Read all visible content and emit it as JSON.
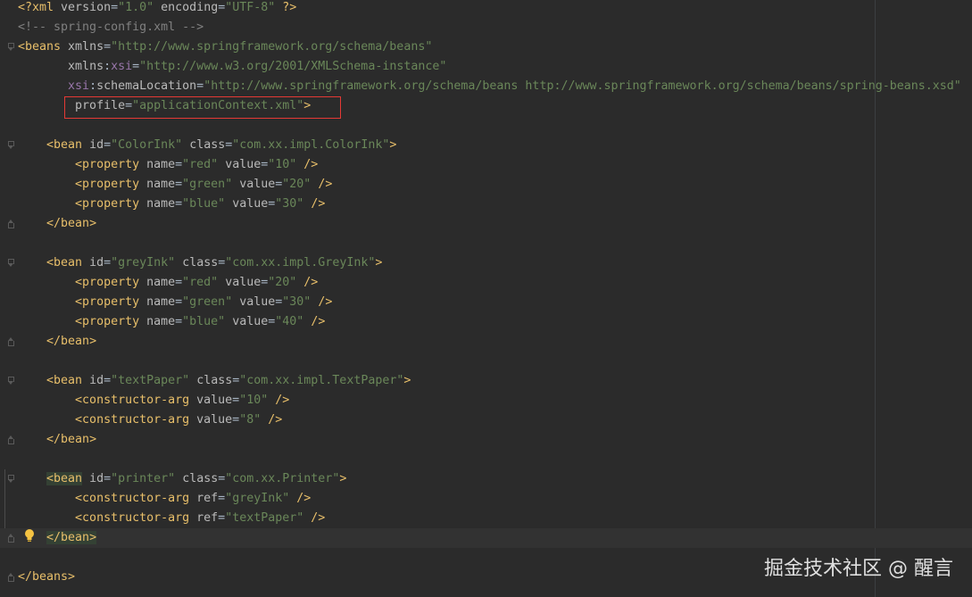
{
  "editor": {
    "language": "xml",
    "filename": "spring-config.xml",
    "highlighted_attribute": "profile=\"applicationContext.xml\"",
    "current_line_index": 27
  },
  "colors": {
    "background": "#2b2b2b",
    "tag": "#e8bf6a",
    "attribute": "#bababa",
    "value": "#6a8759",
    "comment": "#808080",
    "namespace": "#9876aa",
    "highlight_box": "#e53935"
  },
  "lines": [
    {
      "fold": "",
      "tokens": [
        [
          "tag",
          "<?xml "
        ],
        [
          "attr",
          "version"
        ],
        [
          "txt",
          "="
        ],
        [
          "val",
          "\"1.0\""
        ],
        [
          "txt",
          " "
        ],
        [
          "attr",
          "encoding"
        ],
        [
          "txt",
          "="
        ],
        [
          "val",
          "\"UTF-8\""
        ],
        [
          "txt",
          " "
        ],
        [
          "tag",
          "?>"
        ]
      ]
    },
    {
      "fold": "",
      "tokens": [
        [
          "cmt",
          "<!-- spring-config.xml -->"
        ]
      ]
    },
    {
      "fold": "open",
      "tokens": [
        [
          "tag",
          "<beans "
        ],
        [
          "attr",
          "xmlns"
        ],
        [
          "txt",
          "="
        ],
        [
          "val",
          "\"http://www.springframework.org/schema/beans\""
        ]
      ]
    },
    {
      "fold": "",
      "tokens": [
        [
          "txt",
          "       "
        ],
        [
          "attr",
          "xmlns"
        ],
        [
          "txt",
          ":"
        ],
        [
          "ns",
          "xsi"
        ],
        [
          "txt",
          "="
        ],
        [
          "val",
          "\"http://www.w3.org/2001/XMLSchema-instance\""
        ]
      ]
    },
    {
      "fold": "",
      "tokens": [
        [
          "txt",
          "       "
        ],
        [
          "ns",
          "xsi"
        ],
        [
          "txt",
          ":"
        ],
        [
          "attr",
          "schemaLocation"
        ],
        [
          "txt",
          "="
        ],
        [
          "val",
          "\"http://www.springframework.org/schema/beans http://www.springframework.org/schema/beans/spring-beans.xsd\""
        ]
      ]
    },
    {
      "fold": "",
      "tokens": [
        [
          "txt",
          "        "
        ],
        [
          "attr",
          "profile"
        ],
        [
          "txt",
          "="
        ],
        [
          "val",
          "\"applicationContext.xml\""
        ],
        [
          "tag",
          ">"
        ]
      ]
    },
    {
      "fold": "",
      "tokens": []
    },
    {
      "fold": "open",
      "tokens": [
        [
          "txt",
          "    "
        ],
        [
          "tag",
          "<bean "
        ],
        [
          "attr",
          "id"
        ],
        [
          "txt",
          "="
        ],
        [
          "val",
          "\"ColorInk\""
        ],
        [
          "txt",
          " "
        ],
        [
          "attr",
          "class"
        ],
        [
          "txt",
          "="
        ],
        [
          "val",
          "\"com.xx.impl.ColorInk\""
        ],
        [
          "tag",
          ">"
        ]
      ]
    },
    {
      "fold": "",
      "tokens": [
        [
          "txt",
          "        "
        ],
        [
          "tag",
          "<property "
        ],
        [
          "attr",
          "name"
        ],
        [
          "txt",
          "="
        ],
        [
          "val",
          "\"red\""
        ],
        [
          "txt",
          " "
        ],
        [
          "attr",
          "value"
        ],
        [
          "txt",
          "="
        ],
        [
          "val",
          "\"10\""
        ],
        [
          "txt",
          " "
        ],
        [
          "tag",
          "/>"
        ]
      ]
    },
    {
      "fold": "",
      "tokens": [
        [
          "txt",
          "        "
        ],
        [
          "tag",
          "<property "
        ],
        [
          "attr",
          "name"
        ],
        [
          "txt",
          "="
        ],
        [
          "val",
          "\"green\""
        ],
        [
          "txt",
          " "
        ],
        [
          "attr",
          "value"
        ],
        [
          "txt",
          "="
        ],
        [
          "val",
          "\"20\""
        ],
        [
          "txt",
          " "
        ],
        [
          "tag",
          "/>"
        ]
      ]
    },
    {
      "fold": "",
      "tokens": [
        [
          "txt",
          "        "
        ],
        [
          "tag",
          "<property "
        ],
        [
          "attr",
          "name"
        ],
        [
          "txt",
          "="
        ],
        [
          "val",
          "\"blue\""
        ],
        [
          "txt",
          " "
        ],
        [
          "attr",
          "value"
        ],
        [
          "txt",
          "="
        ],
        [
          "val",
          "\"30\""
        ],
        [
          "txt",
          " "
        ],
        [
          "tag",
          "/>"
        ]
      ]
    },
    {
      "fold": "close",
      "tokens": [
        [
          "txt",
          "    "
        ],
        [
          "tag",
          "</bean>"
        ]
      ]
    },
    {
      "fold": "",
      "tokens": []
    },
    {
      "fold": "open",
      "tokens": [
        [
          "txt",
          "    "
        ],
        [
          "tag",
          "<bean "
        ],
        [
          "attr",
          "id"
        ],
        [
          "txt",
          "="
        ],
        [
          "val",
          "\"greyInk\""
        ],
        [
          "txt",
          " "
        ],
        [
          "attr",
          "class"
        ],
        [
          "txt",
          "="
        ],
        [
          "val",
          "\"com.xx.impl.GreyInk\""
        ],
        [
          "tag",
          ">"
        ]
      ]
    },
    {
      "fold": "",
      "tokens": [
        [
          "txt",
          "        "
        ],
        [
          "tag",
          "<property "
        ],
        [
          "attr",
          "name"
        ],
        [
          "txt",
          "="
        ],
        [
          "val",
          "\"red\""
        ],
        [
          "txt",
          " "
        ],
        [
          "attr",
          "value"
        ],
        [
          "txt",
          "="
        ],
        [
          "val",
          "\"20\""
        ],
        [
          "txt",
          " "
        ],
        [
          "tag",
          "/>"
        ]
      ]
    },
    {
      "fold": "",
      "tokens": [
        [
          "txt",
          "        "
        ],
        [
          "tag",
          "<property "
        ],
        [
          "attr",
          "name"
        ],
        [
          "txt",
          "="
        ],
        [
          "val",
          "\"green\""
        ],
        [
          "txt",
          " "
        ],
        [
          "attr",
          "value"
        ],
        [
          "txt",
          "="
        ],
        [
          "val",
          "\"30\""
        ],
        [
          "txt",
          " "
        ],
        [
          "tag",
          "/>"
        ]
      ]
    },
    {
      "fold": "",
      "tokens": [
        [
          "txt",
          "        "
        ],
        [
          "tag",
          "<property "
        ],
        [
          "attr",
          "name"
        ],
        [
          "txt",
          "="
        ],
        [
          "val",
          "\"blue\""
        ],
        [
          "txt",
          " "
        ],
        [
          "attr",
          "value"
        ],
        [
          "txt",
          "="
        ],
        [
          "val",
          "\"40\""
        ],
        [
          "txt",
          " "
        ],
        [
          "tag",
          "/>"
        ]
      ]
    },
    {
      "fold": "close",
      "tokens": [
        [
          "txt",
          "    "
        ],
        [
          "tag",
          "</bean>"
        ]
      ]
    },
    {
      "fold": "",
      "tokens": []
    },
    {
      "fold": "open",
      "tokens": [
        [
          "txt",
          "    "
        ],
        [
          "tag",
          "<bean "
        ],
        [
          "attr",
          "id"
        ],
        [
          "txt",
          "="
        ],
        [
          "val",
          "\"textPaper\""
        ],
        [
          "txt",
          " "
        ],
        [
          "attr",
          "class"
        ],
        [
          "txt",
          "="
        ],
        [
          "val",
          "\"com.xx.impl.TextPaper\""
        ],
        [
          "tag",
          ">"
        ]
      ]
    },
    {
      "fold": "",
      "tokens": [
        [
          "txt",
          "        "
        ],
        [
          "tag",
          "<constructor-arg "
        ],
        [
          "attr",
          "value"
        ],
        [
          "txt",
          "="
        ],
        [
          "val",
          "\"10\""
        ],
        [
          "txt",
          " "
        ],
        [
          "tag",
          "/>"
        ]
      ]
    },
    {
      "fold": "",
      "tokens": [
        [
          "txt",
          "        "
        ],
        [
          "tag",
          "<constructor-arg "
        ],
        [
          "attr",
          "value"
        ],
        [
          "txt",
          "="
        ],
        [
          "val",
          "\"8\""
        ],
        [
          "txt",
          " "
        ],
        [
          "tag",
          "/>"
        ]
      ]
    },
    {
      "fold": "close",
      "tokens": [
        [
          "txt",
          "    "
        ],
        [
          "tag",
          "</bean>"
        ]
      ]
    },
    {
      "fold": "",
      "tokens": []
    },
    {
      "fold": "open",
      "tokens": [
        [
          "txt",
          "    "
        ],
        [
          "taghl",
          "<bean"
        ],
        [
          "tag",
          " "
        ],
        [
          "attr",
          "id"
        ],
        [
          "txt",
          "="
        ],
        [
          "val",
          "\"printer\""
        ],
        [
          "txt",
          " "
        ],
        [
          "attr",
          "class"
        ],
        [
          "txt",
          "="
        ],
        [
          "val",
          "\"com.xx.Printer\""
        ],
        [
          "tag",
          ">"
        ]
      ]
    },
    {
      "fold": "",
      "tokens": [
        [
          "txt",
          "        "
        ],
        [
          "tag",
          "<constructor-arg "
        ],
        [
          "attr",
          "ref"
        ],
        [
          "txt",
          "="
        ],
        [
          "val",
          "\"greyInk\""
        ],
        [
          "txt",
          " "
        ],
        [
          "tag",
          "/>"
        ]
      ]
    },
    {
      "fold": "",
      "tokens": [
        [
          "txt",
          "        "
        ],
        [
          "tag",
          "<constructor-arg "
        ],
        [
          "attr",
          "ref"
        ],
        [
          "txt",
          "="
        ],
        [
          "val",
          "\"textPaper\""
        ],
        [
          "txt",
          " "
        ],
        [
          "tag",
          "/>"
        ]
      ]
    },
    {
      "fold": "close",
      "tokens": [
        [
          "txt",
          "    "
        ],
        [
          "taghl",
          "</bean>"
        ]
      ]
    },
    {
      "fold": "",
      "tokens": []
    },
    {
      "fold": "close",
      "tokens": [
        [
          "tag",
          "</beans>"
        ]
      ]
    }
  ],
  "watermark": "掘金技术社区 @ 醒言",
  "icons": {
    "intention_bulb": "lightbulb-icon",
    "fold_open": "fold-open-icon",
    "fold_close": "fold-close-icon"
  }
}
